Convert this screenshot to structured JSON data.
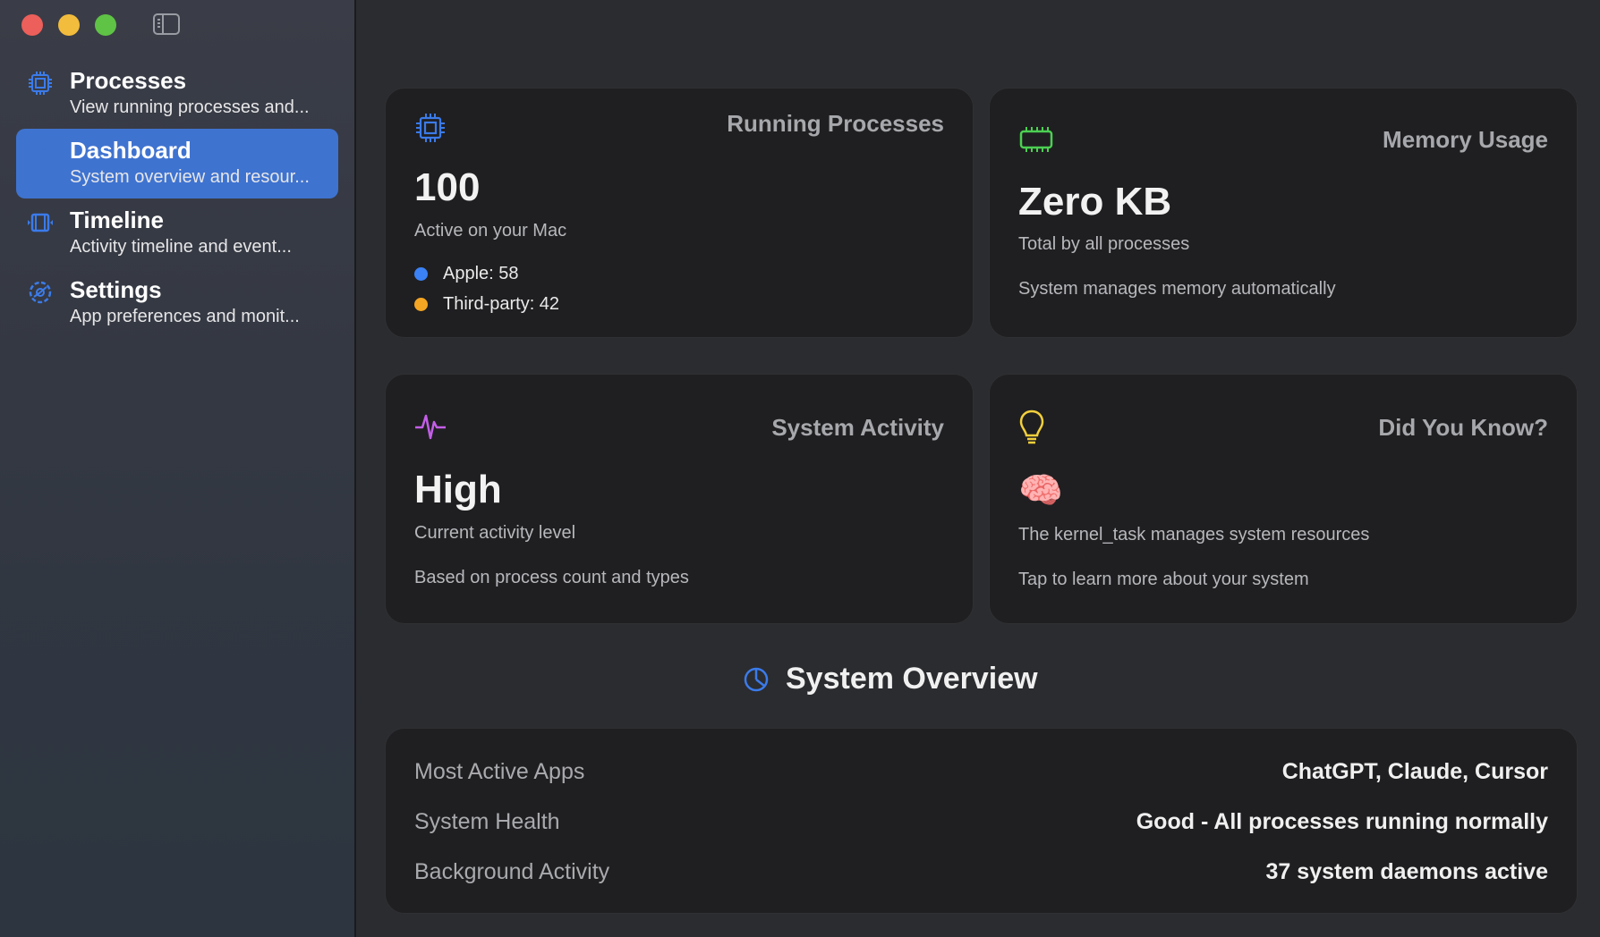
{
  "sidebar": {
    "items": [
      {
        "title": "Processes",
        "subtitle": "View running processes and...",
        "icon": "cpu-chip-icon"
      },
      {
        "title": "Dashboard",
        "subtitle": "System overview and resour...",
        "icon": "gauge-icon",
        "active": true
      },
      {
        "title": "Timeline",
        "subtitle": "Activity timeline and event...",
        "icon": "timeline-icon"
      },
      {
        "title": "Settings",
        "subtitle": "App preferences and monit...",
        "icon": "gear-icon"
      }
    ]
  },
  "cards": {
    "running": {
      "title": "Running Processes",
      "value": "100",
      "caption": "Active on your Mac",
      "legend": [
        {
          "label": "Apple: 58",
          "color": "#3b82f6"
        },
        {
          "label": "Third-party: 42",
          "color": "#f5a623"
        }
      ],
      "icon": "cpu-chip-icon",
      "icon_color": "#3b7bea"
    },
    "memory": {
      "title": "Memory Usage",
      "value": "Zero KB",
      "caption": "Total by all processes",
      "note": "System manages memory automatically",
      "icon": "memory-chip-icon",
      "icon_color": "#4ccf52"
    },
    "activity": {
      "title": "System Activity",
      "value": "High",
      "caption": "Current activity level",
      "note": "Based on process count and types",
      "icon": "waveform-icon",
      "icon_color": "#c45ee8"
    },
    "didyouknow": {
      "title": "Did You Know?",
      "emoji": "🧠",
      "caption": "The kernel_task manages system resources",
      "note": "Tap to learn more about your system",
      "icon": "lightbulb-icon",
      "icon_color": "#f2cf3c"
    }
  },
  "overview": {
    "title": "System Overview",
    "icon": "pie-chart-icon",
    "rows": [
      {
        "label": "Most Active Apps",
        "value": "ChatGPT, Claude, Cursor"
      },
      {
        "label": "System Health",
        "value": "Good - All processes running normally"
      },
      {
        "label": "Background Activity",
        "value": "37 system daemons active"
      }
    ]
  }
}
